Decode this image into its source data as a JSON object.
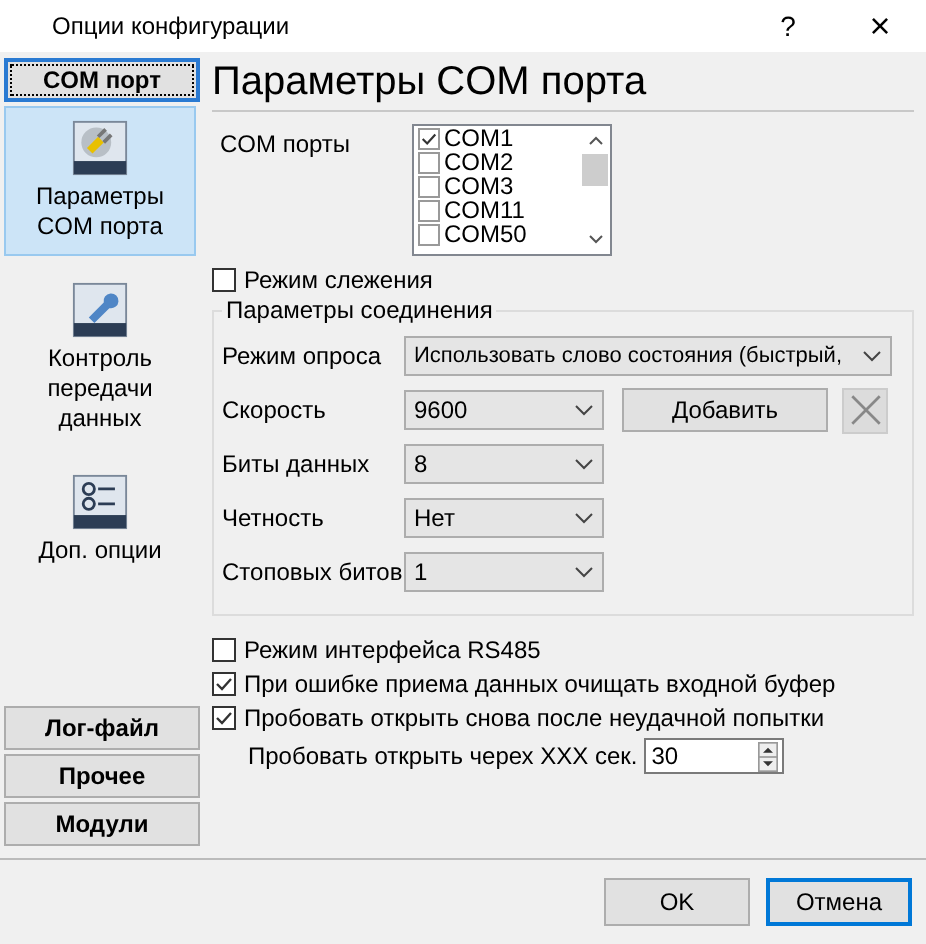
{
  "window": {
    "title": "Опции конфигурации",
    "help": "?",
    "close": "×"
  },
  "sidebar": {
    "top_sections": [
      {
        "label": "COM порт",
        "selected": true
      }
    ],
    "items": [
      {
        "label": "Параметры COM порта",
        "selected": true
      },
      {
        "label": "Контроль передачи данных",
        "selected": false
      },
      {
        "label": "Доп. опции",
        "selected": false
      }
    ],
    "bottom_sections": [
      {
        "label": "Лог-файл",
        "selected": false
      },
      {
        "label": "Прочее",
        "selected": false
      },
      {
        "label": "Модули",
        "selected": false
      }
    ]
  },
  "page": {
    "title": "Параметры COM порта",
    "com_ports_label": "COM порты",
    "com_ports": [
      {
        "name": "COM1",
        "checked": true
      },
      {
        "name": "COM2",
        "checked": false
      },
      {
        "name": "COM3",
        "checked": false
      },
      {
        "name": "COM11",
        "checked": false
      },
      {
        "name": "COM50",
        "checked": false
      }
    ],
    "monitor_mode": {
      "label": "Режим слежения",
      "checked": false
    },
    "connection_group": {
      "title": "Параметры соединения",
      "fields": [
        {
          "label": "Режим опроса",
          "value": "Использовать слово состояния (быстрый,"
        },
        {
          "label": "Скорость",
          "value": "9600",
          "add_button": "Добавить"
        },
        {
          "label": "Биты данных",
          "value": "8"
        },
        {
          "label": "Четность",
          "value": "Нет"
        },
        {
          "label": "Стоповых битов",
          "value": "1"
        }
      ]
    },
    "options": [
      {
        "kind": "checkbox",
        "label": "Режим интерфейса RS485",
        "checked": false
      },
      {
        "kind": "checkbox",
        "label": "При ошибке приема данных очищать входной буфер",
        "checked": true
      },
      {
        "kind": "checkbox",
        "label": "Пробовать открыть снова после неудачной попытки",
        "checked": true
      },
      {
        "kind": "spinner",
        "label": "Пробовать открыть черех XXX сек.",
        "value": "30"
      }
    ]
  },
  "footer": {
    "buttons": [
      {
        "label": "OK",
        "focused": false
      },
      {
        "label": "Отмена",
        "focused": true
      }
    ]
  }
}
